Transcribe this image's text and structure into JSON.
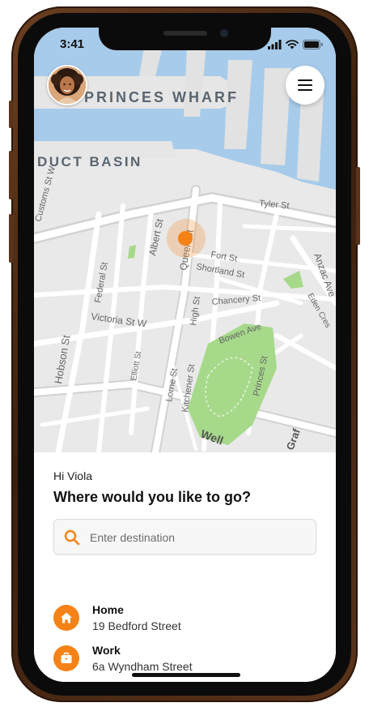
{
  "status_bar": {
    "time": "3:41",
    "icons": [
      "signal-icon",
      "wifi-icon",
      "battery-icon"
    ]
  },
  "map": {
    "labels": {
      "princes_wharf": "PRINCES WHARF",
      "viaduct_basin": "DUCT BASIN",
      "customs_st": "Customs St W",
      "albert_st": "Albert St",
      "queen_st": "Queen St",
      "fort_st": "Fort St",
      "shortland_st": "Shortland St",
      "chancery_st": "Chancery St",
      "tyler_st": "Tyler St",
      "anzac_ave": "Anzac Ave",
      "eden_cres": "Eden Cres",
      "federal_st": "Federal St",
      "victoria_st": "Victoria St W",
      "hobson_st": "Hobson St",
      "high_st": "High St",
      "bowen_ave": "Bowen Ave",
      "princes_st": "Princes St",
      "elliott_st": "Elliott St",
      "lorne_st": "Lorne St",
      "kitchener_st": "Kitchener St",
      "wellesley": "Well",
      "grafton": "Graf"
    },
    "colors": {
      "water": "#a7cbea",
      "land": "#e9e9e9",
      "road": "#ffffff",
      "park": "#a6d98a",
      "accent": "#f58216"
    }
  },
  "user": {
    "avatar_icon": "user-avatar"
  },
  "panel": {
    "greeting": "Hi Viola",
    "question": "Where would you like to go?",
    "search_placeholder": "Enter destination",
    "places": [
      {
        "icon": "home-icon",
        "name": "Home",
        "address": "19 Bedford Street"
      },
      {
        "icon": "briefcase-icon",
        "name": "Work",
        "address": "6a Wyndham Street"
      }
    ]
  }
}
